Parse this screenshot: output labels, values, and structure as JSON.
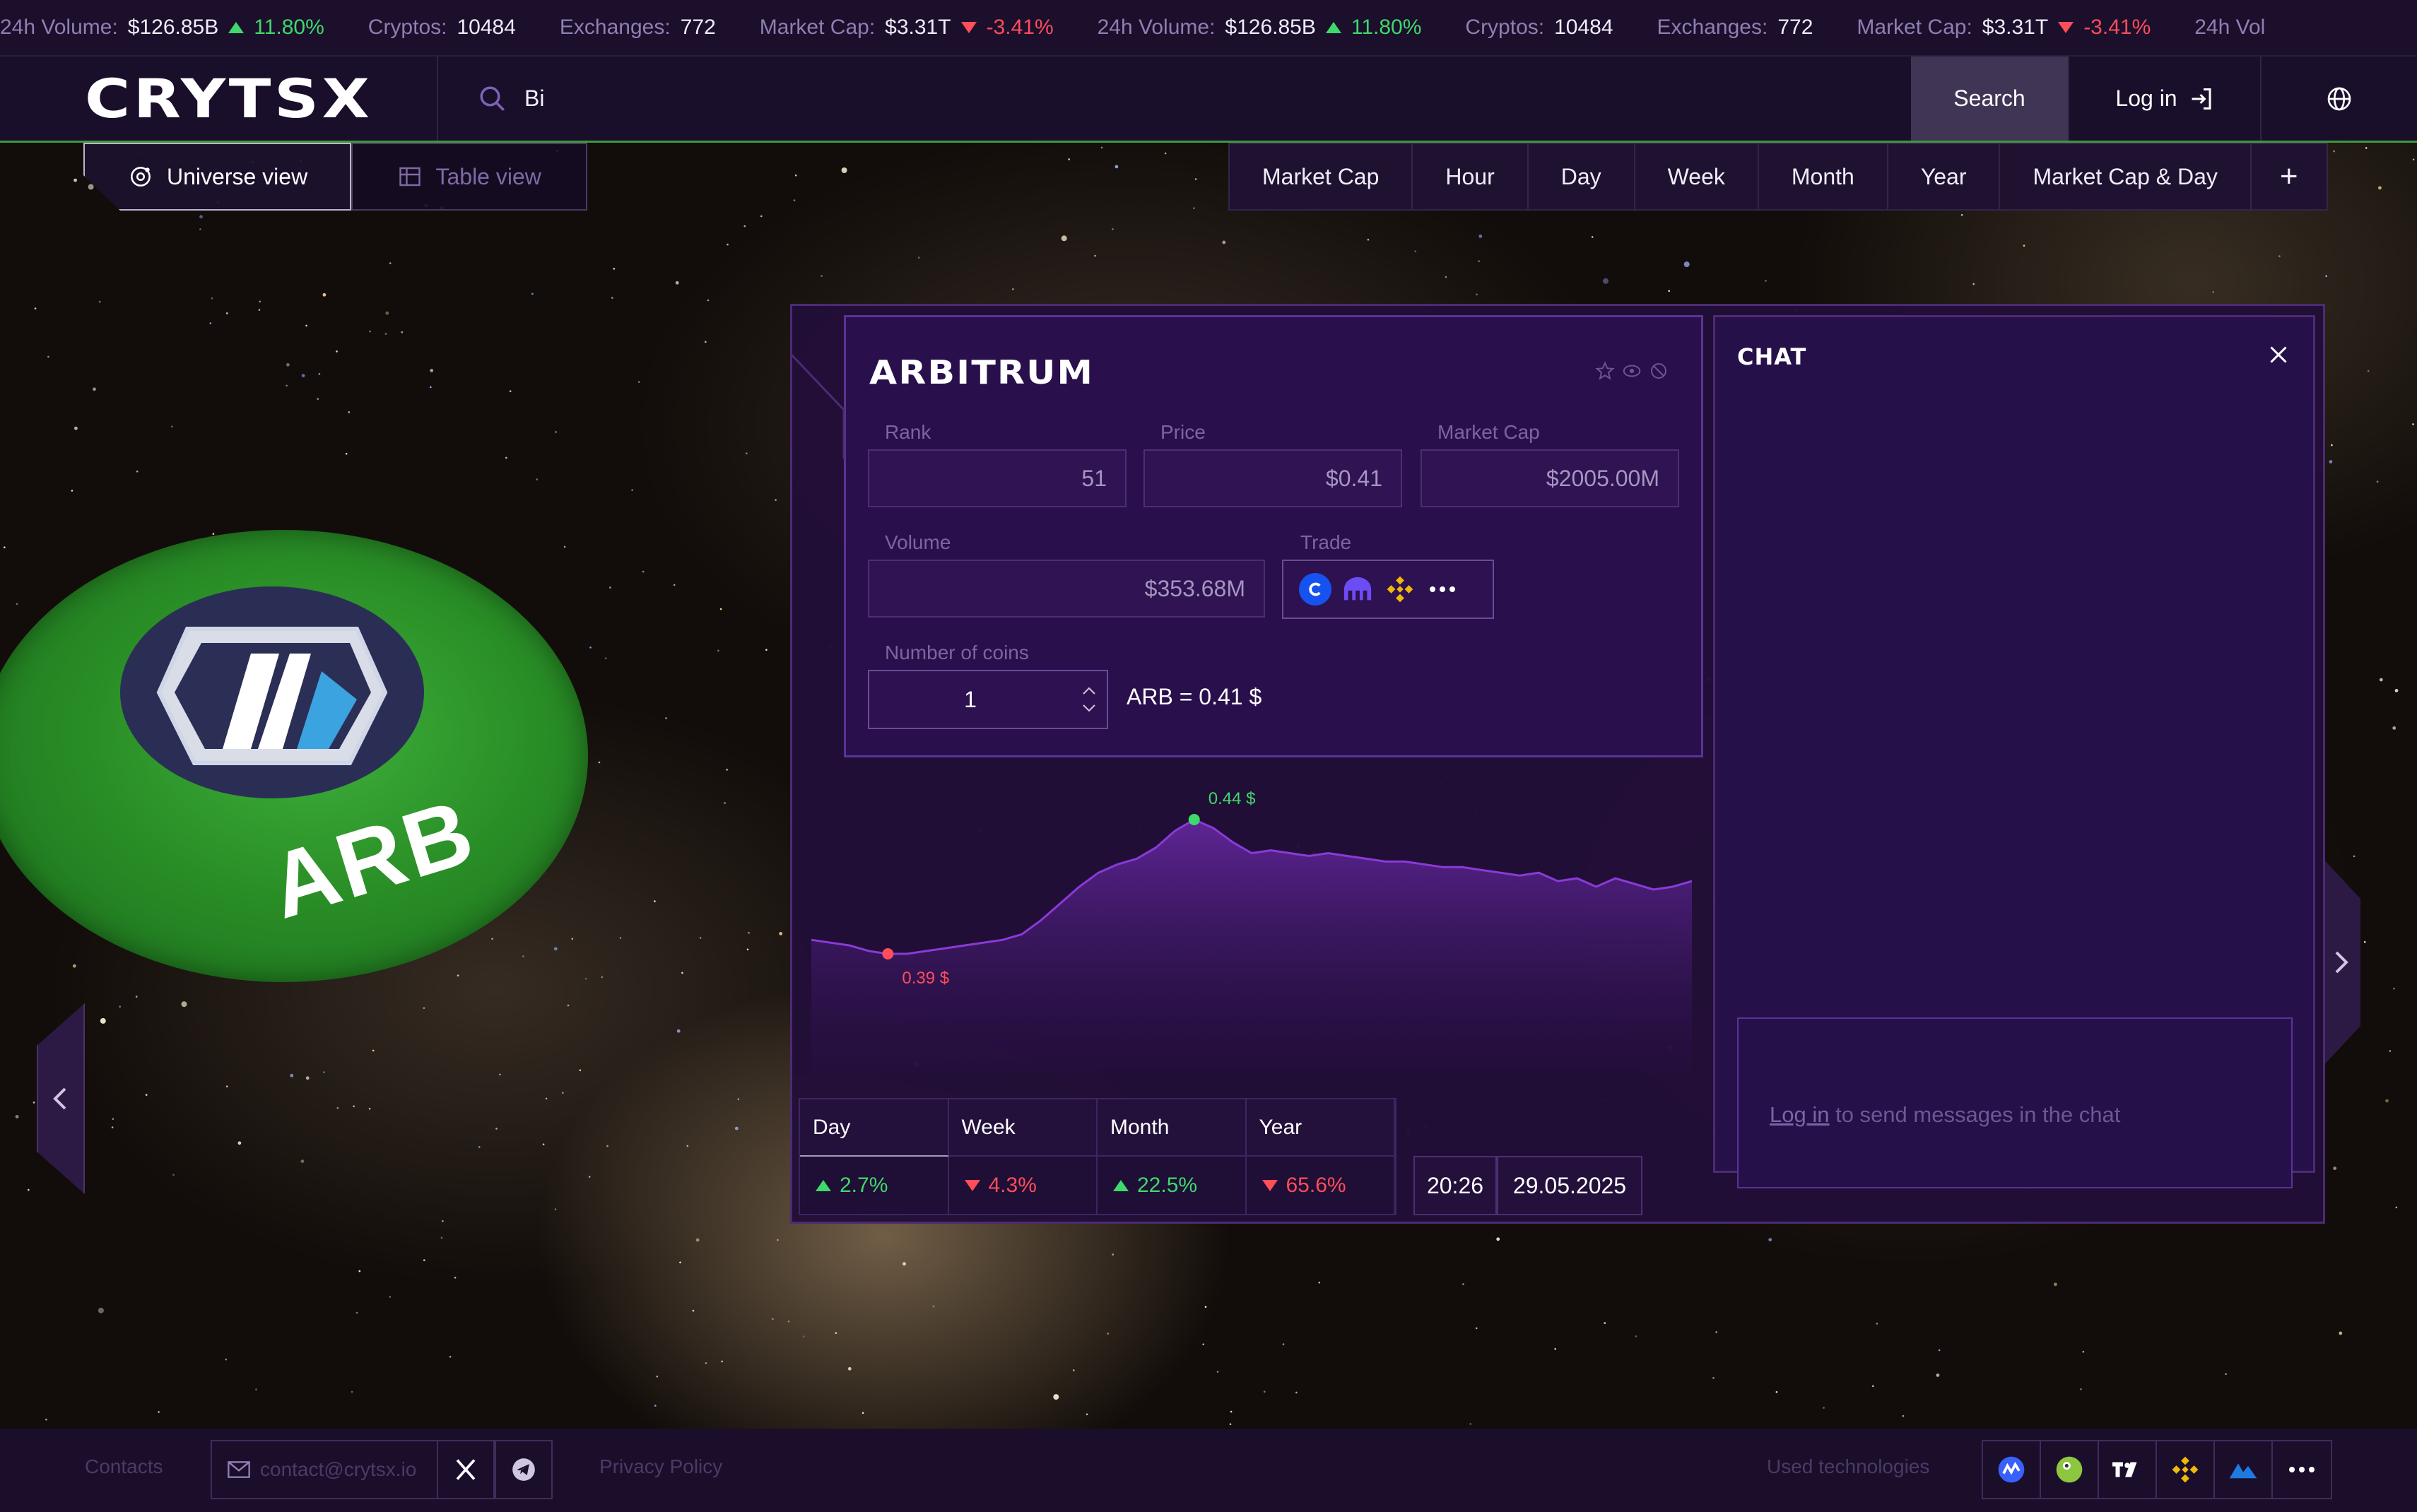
{
  "ticker": {
    "items": [
      {
        "label": "24h Volume:",
        "value": "$126.85B",
        "change": "11.80%",
        "dir": "up"
      },
      {
        "label": "Cryptos:",
        "value": "10484"
      },
      {
        "label": "Exchanges:",
        "value": "772"
      },
      {
        "label": "Market Cap:",
        "value": "$3.31T",
        "change": "-3.41%",
        "dir": "down"
      },
      {
        "label": "24h Volume:",
        "value": "$126.85B",
        "change": "11.80%",
        "dir": "up"
      },
      {
        "label": "Cryptos:",
        "value": "10484"
      },
      {
        "label": "Exchanges:",
        "value": "772"
      },
      {
        "label": "Market Cap:",
        "value": "$3.31T",
        "change": "-3.41%",
        "dir": "down"
      },
      {
        "label": "24h Vol"
      }
    ]
  },
  "header": {
    "logo": "CRYTSX",
    "search_value": "Bi",
    "search_button": "Search",
    "login_label": "Log in",
    "globe_icon": "globe-icon"
  },
  "views": {
    "universe": "Universe view",
    "table": "Table view"
  },
  "sort_tabs": [
    "Market Cap",
    "Hour",
    "Day",
    "Week",
    "Month",
    "Year",
    "Market Cap & Day",
    "+"
  ],
  "coin": {
    "ticker": "ARB",
    "disk_color": "#2a8f27"
  },
  "card": {
    "title": "ARBITRUM",
    "rank_label": "Rank",
    "rank": "51",
    "price_label": "Price",
    "price": "$0.41",
    "mcap_label": "Market Cap",
    "mcap": "$2005.00M",
    "volume_label": "Volume",
    "volume": "$353.68M",
    "trade_label": "Trade",
    "trade_icons": [
      "coinbase-icon",
      "kraken-icon",
      "binance-icon",
      "more-icon"
    ],
    "coins_label": "Number of coins",
    "coins_value": "1",
    "conversion": "ARB = 0.41 $",
    "high_label": "0.44 $",
    "low_label": "0.39 $",
    "high_color": "#3fd86a",
    "low_color": "#ff4d5a"
  },
  "chart_data": {
    "type": "area",
    "y": [
      0.397,
      0.396,
      0.395,
      0.393,
      0.392,
      0.392,
      0.393,
      0.394,
      0.395,
      0.396,
      0.397,
      0.399,
      0.404,
      0.41,
      0.416,
      0.421,
      0.424,
      0.426,
      0.43,
      0.436,
      0.44,
      0.437,
      0.432,
      0.428,
      0.429,
      0.428,
      0.427,
      0.428,
      0.427,
      0.426,
      0.425,
      0.425,
      0.424,
      0.423,
      0.423,
      0.422,
      0.421,
      0.42,
      0.421,
      0.418,
      0.419,
      0.416,
      0.419,
      0.417,
      0.415,
      0.416,
      0.418
    ],
    "high": 0.44,
    "low": 0.392,
    "line_color": "#8a3ad8"
  },
  "periods": {
    "headers": [
      "Day",
      "Week",
      "Month",
      "Year"
    ],
    "values": [
      {
        "text": "2.7%",
        "dir": "up"
      },
      {
        "text": "4.3%",
        "dir": "down"
      },
      {
        "text": "22.5%",
        "dir": "up"
      },
      {
        "text": "65.6%",
        "dir": "down"
      }
    ]
  },
  "datetime": {
    "time": "20:26",
    "date": "29.05.2025"
  },
  "chat": {
    "title": "CHAT",
    "login_link": "Log in",
    "message": " to send messages in the chat"
  },
  "footer": {
    "contacts": "Contacts",
    "email": "contact@crytsx.io",
    "privacy": "Privacy Policy",
    "used_tech": "Used technologies",
    "tech_icons": [
      "coinmarketcap-icon",
      "coingecko-icon",
      "tradingview-icon",
      "binance-icon",
      "kraken-icon",
      "more-icon"
    ]
  }
}
